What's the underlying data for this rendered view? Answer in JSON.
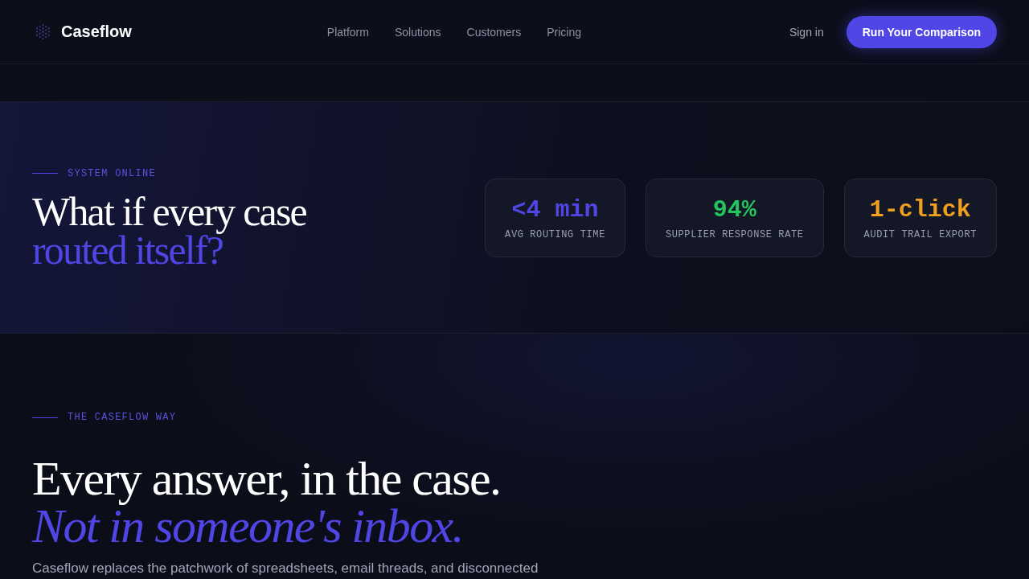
{
  "nav": {
    "brand": "Caseflow",
    "links": [
      "Platform",
      "Solutions",
      "Customers",
      "Pricing"
    ],
    "sign_in": "Sign in",
    "cta": "Run Your Comparison"
  },
  "hero": {
    "eyebrow": "SYSTEM ONLINE",
    "title": "What if every case",
    "title_accent": "routed itself?",
    "stats": [
      {
        "value": "<4 min",
        "label": "AVG ROUTING TIME",
        "color": "#4f46e5"
      },
      {
        "value": "94%",
        "label": "SUPPLIER RESPONSE RATE",
        "color": "#22c55e"
      },
      {
        "value": "1-click",
        "label": "AUDIT TRAIL EXPORT",
        "color": "#f0a020"
      }
    ]
  },
  "way": {
    "eyebrow": "THE CASEFLOW WAY",
    "title": "Every answer, in the case.",
    "title_accent": "Not in someone's inbox.",
    "body": "Caseflow replaces the patchwork of spreadsheets, email threads, and disconnected"
  }
}
